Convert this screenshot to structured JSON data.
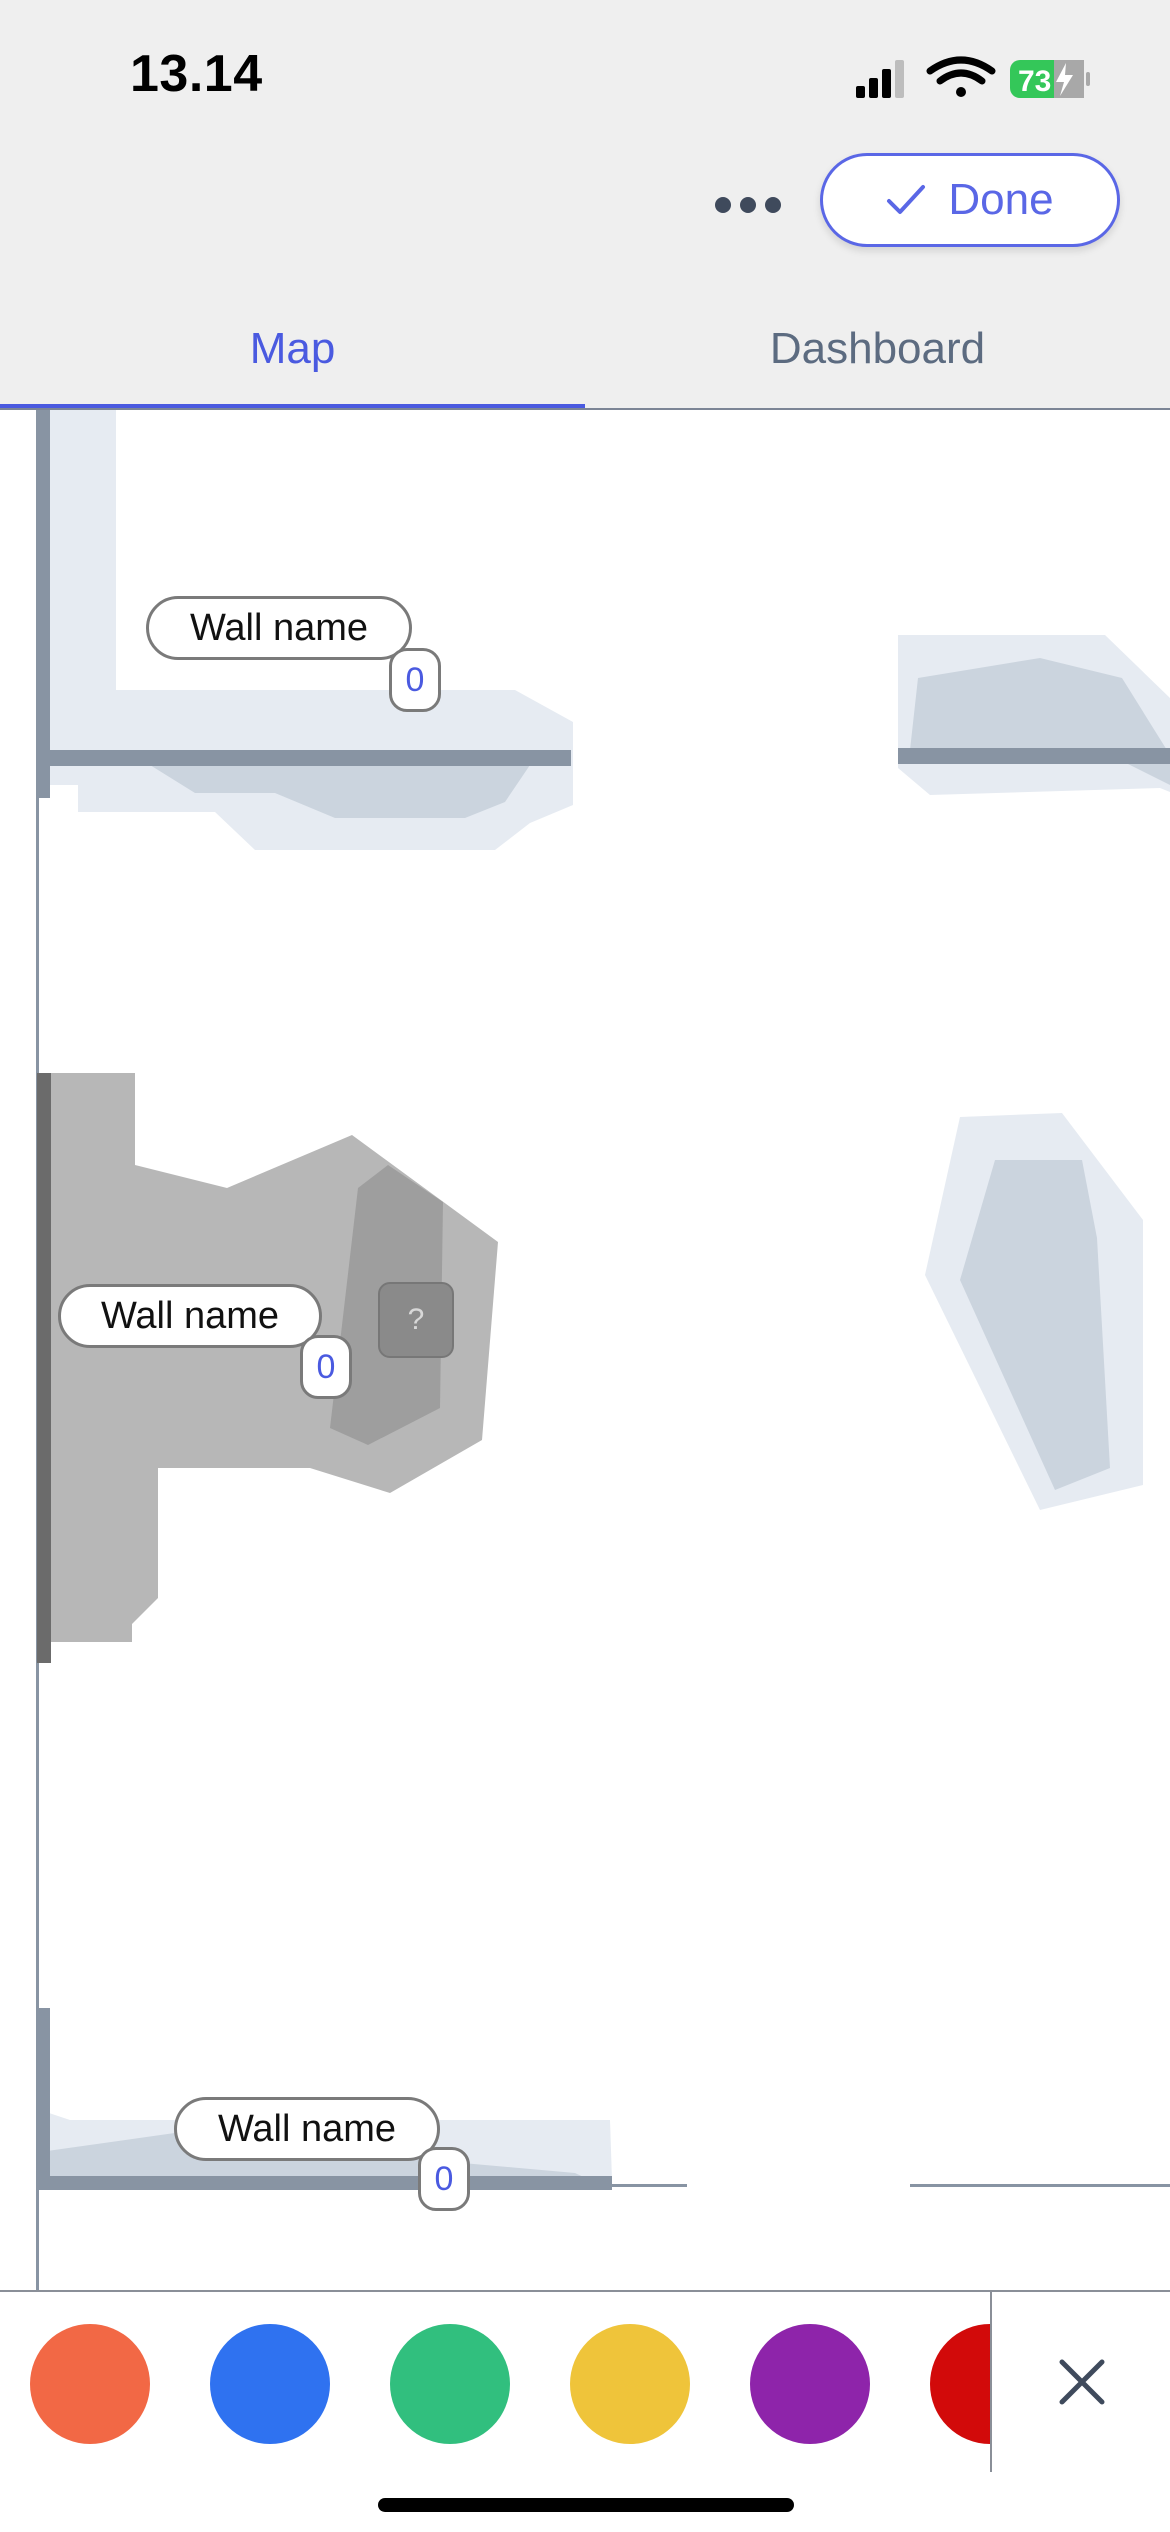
{
  "status_bar": {
    "time": "13.14",
    "battery_level": "73",
    "icons": [
      "cellular-signal-icon",
      "wifi-icon",
      "battery-charging-icon"
    ]
  },
  "toolbar": {
    "more_icon": "ellipsis-icon",
    "done_label": "Done",
    "done_icon": "checkmark-icon"
  },
  "tabs": [
    {
      "label": "Map",
      "selected": true
    },
    {
      "label": "Dashboard",
      "selected": false
    }
  ],
  "map": {
    "walls": [
      {
        "label": "Wall name",
        "count": "0"
      },
      {
        "label": "Wall name",
        "count": "0"
      },
      {
        "label": "Wall name",
        "count": "0"
      }
    ],
    "unknown_marker": "?"
  },
  "palette": {
    "colors": [
      "#f26845",
      "#2f72f0",
      "#31bf7e",
      "#efc43a",
      "#8e24aa",
      "#d20a0a"
    ],
    "close_icon": "close-icon"
  },
  "theme": {
    "accent": "#4a5ae0",
    "header_background": "#efefef",
    "battery_green": "#34c759"
  }
}
